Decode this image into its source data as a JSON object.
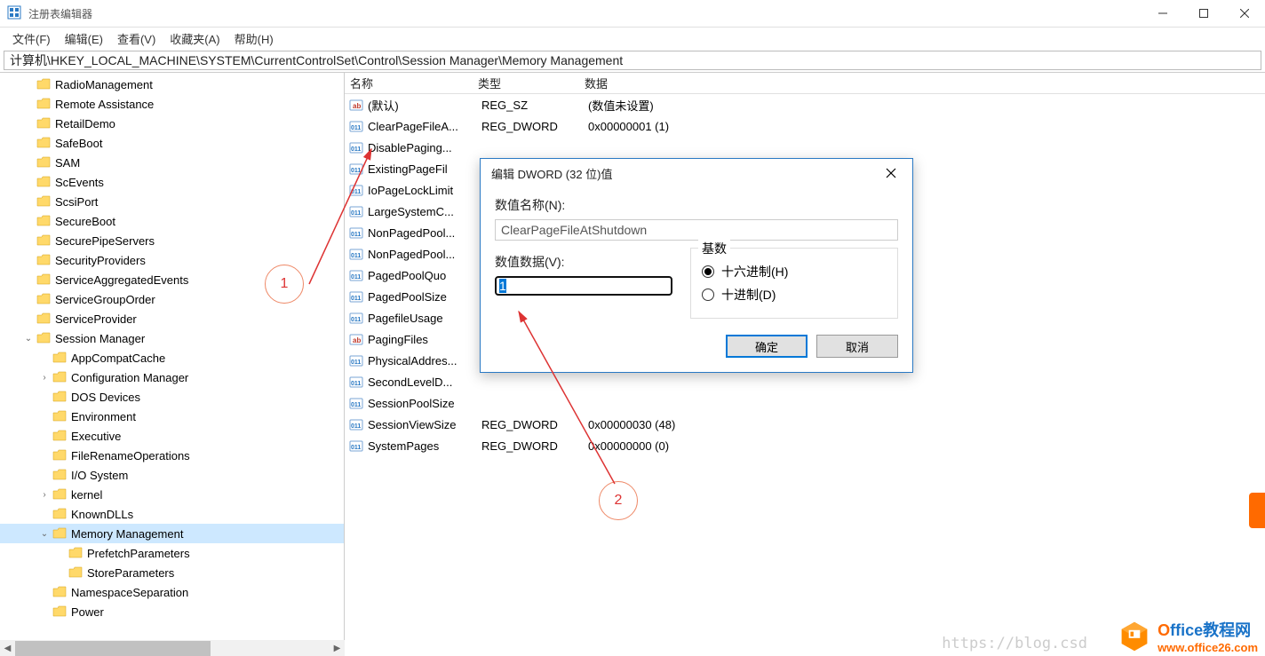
{
  "window": {
    "title": "注册表编辑器"
  },
  "menu": {
    "file": "文件(F)",
    "edit": "编辑(E)",
    "view": "查看(V)",
    "favorites": "收藏夹(A)",
    "help": "帮助(H)"
  },
  "address": "计算机\\HKEY_LOCAL_MACHINE\\SYSTEM\\CurrentControlSet\\Control\\Session Manager\\Memory Management",
  "tree": [
    {
      "label": "RadioManagement",
      "depth": 1
    },
    {
      "label": "Remote Assistance",
      "depth": 1
    },
    {
      "label": "RetailDemo",
      "depth": 1
    },
    {
      "label": "SafeBoot",
      "depth": 1
    },
    {
      "label": "SAM",
      "depth": 1
    },
    {
      "label": "ScEvents",
      "depth": 1
    },
    {
      "label": "ScsiPort",
      "depth": 1
    },
    {
      "label": "SecureBoot",
      "depth": 1
    },
    {
      "label": "SecurePipeServers",
      "depth": 1
    },
    {
      "label": "SecurityProviders",
      "depth": 1
    },
    {
      "label": "ServiceAggregatedEvents",
      "depth": 1
    },
    {
      "label": "ServiceGroupOrder",
      "depth": 1
    },
    {
      "label": "ServiceProvider",
      "depth": 1
    },
    {
      "label": "Session Manager",
      "depth": 1,
      "expanded": true
    },
    {
      "label": "AppCompatCache",
      "depth": 2
    },
    {
      "label": "Configuration Manager",
      "depth": 2,
      "expander": ">"
    },
    {
      "label": "DOS Devices",
      "depth": 2
    },
    {
      "label": "Environment",
      "depth": 2
    },
    {
      "label": "Executive",
      "depth": 2
    },
    {
      "label": "FileRenameOperations",
      "depth": 2
    },
    {
      "label": "I/O System",
      "depth": 2
    },
    {
      "label": "kernel",
      "depth": 2,
      "expander": ">"
    },
    {
      "label": "KnownDLLs",
      "depth": 2
    },
    {
      "label": "Memory Management",
      "depth": 2,
      "expander": "v",
      "selected": true
    },
    {
      "label": "PrefetchParameters",
      "depth": 3
    },
    {
      "label": "StoreParameters",
      "depth": 3
    },
    {
      "label": "NamespaceSeparation",
      "depth": 2
    },
    {
      "label": "Power",
      "depth": 2
    }
  ],
  "list": {
    "headers": {
      "name": "名称",
      "type": "类型",
      "data": "数据"
    },
    "rows": [
      {
        "icon": "sz",
        "name": "(默认)",
        "type": "REG_SZ",
        "data": "(数值未设置)"
      },
      {
        "icon": "dw",
        "name": "ClearPageFileA...",
        "type": "REG_DWORD",
        "data": "0x00000001 (1)",
        "arrow": true
      },
      {
        "icon": "dw",
        "name": "DisablePaging...",
        "type": "",
        "data": ""
      },
      {
        "icon": "dw",
        "name": "ExistingPageFil",
        "type": "",
        "data": ""
      },
      {
        "icon": "dw",
        "name": "IoPageLockLimit",
        "type": "",
        "data": ""
      },
      {
        "icon": "dw",
        "name": "LargeSystemC...",
        "type": "",
        "data": ""
      },
      {
        "icon": "dw",
        "name": "NonPagedPool...",
        "type": "",
        "data": ""
      },
      {
        "icon": "dw",
        "name": "NonPagedPool...",
        "type": "",
        "data": ""
      },
      {
        "icon": "dw",
        "name": "PagedPoolQuo",
        "type": "",
        "data": ""
      },
      {
        "icon": "dw",
        "name": "PagedPoolSize",
        "type": "",
        "data": ""
      },
      {
        "icon": "dw",
        "name": "PagefileUsage",
        "type": "",
        "data": ""
      },
      {
        "icon": "sz",
        "name": "PagingFiles",
        "type": "",
        "data": ""
      },
      {
        "icon": "dw",
        "name": "PhysicalAddres...",
        "type": "",
        "data": ""
      },
      {
        "icon": "dw",
        "name": "SecondLevelD...",
        "type": "",
        "data": ""
      },
      {
        "icon": "dw",
        "name": "SessionPoolSize",
        "type": "",
        "data": ""
      },
      {
        "icon": "dw",
        "name": "SessionViewSize",
        "type": "REG_DWORD",
        "data": "0x00000030 (48)"
      },
      {
        "icon": "dw",
        "name": "SystemPages",
        "type": "REG_DWORD",
        "data": "0x00000000 (0)"
      }
    ]
  },
  "dialog": {
    "title": "编辑 DWORD (32 位)值",
    "name_label": "数值名称(N):",
    "name_value": "ClearPageFileAtShutdown",
    "value_label": "数值数据(V):",
    "value_value": "1",
    "base_label": "基数",
    "radio_hex": "十六进制(H)",
    "radio_dec": "十进制(D)",
    "ok": "确定",
    "cancel": "取消"
  },
  "annotations": {
    "one": "1",
    "two": "2"
  },
  "watermark": "https://blog.csd",
  "logo": {
    "line1a": "O",
    "line1b": "ffice教程网",
    "line2": "www.office26.com"
  }
}
